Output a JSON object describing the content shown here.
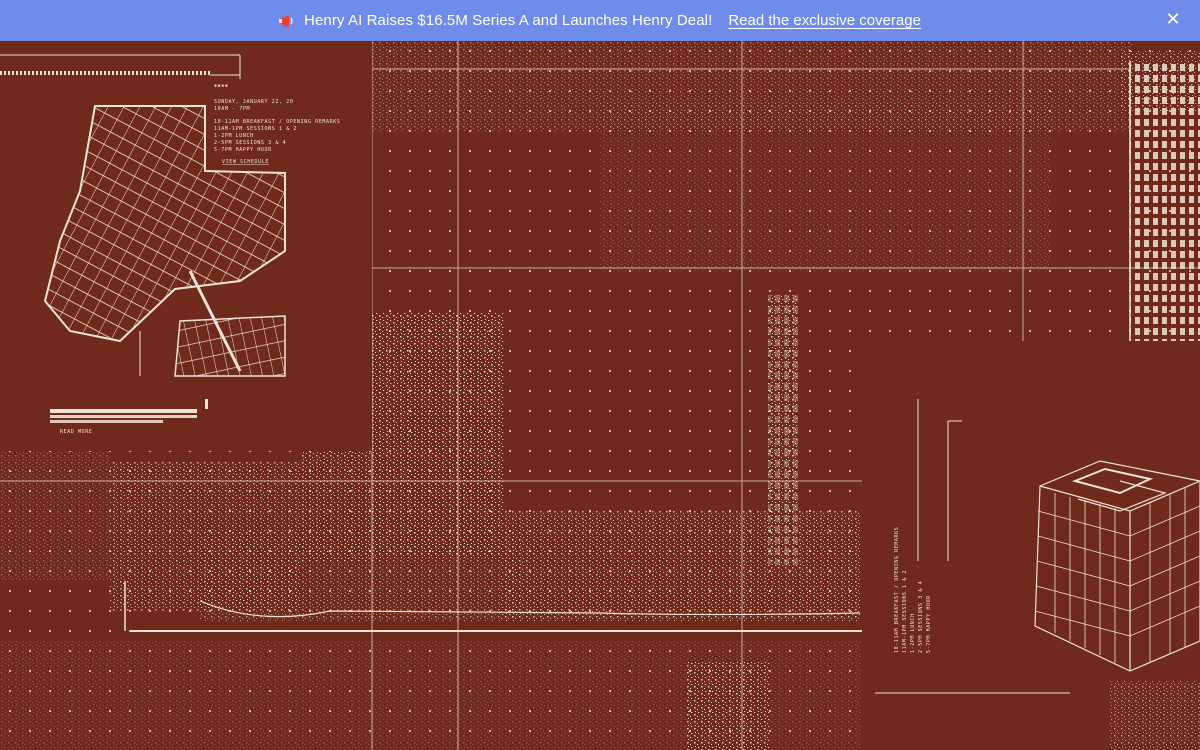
{
  "banner": {
    "icon": "megaphone-icon",
    "message": "Henry AI Raises $16.5M Series A and Launches Henry Deal!",
    "link_text": "Read the exclusive coverage",
    "close_icon": "close-icon",
    "background": "#6f8cea"
  },
  "hero": {
    "background": "#702a1c",
    "ink": "#efe3d6",
    "schedule_date": "SUNDAY, JANUARY 22, 20",
    "schedule_time": "10AM - 7PM",
    "schedule_rows": [
      "10-11AM   BREAKFAST / OPENING REMARKS",
      "11AM-1PM  SESSIONS 1 & 2",
      "1-2PM     LUNCH",
      "2-5PM     SESSIONS 3 & 4",
      "5-7PM     HAPPY HOUR"
    ],
    "view_schedule": "VIEW SCHEDULE",
    "read_more": "READ MORE",
    "vertical_rows": [
      "10-11AM   BREAKFAST / OPENING REMARKS",
      "11AM-1PM  SESSIONS 1 & 2",
      "1-2PM     LUNCH",
      "2-5PM     SESSIONS 3 & 4",
      "5-7PM     HAPPY HOUR"
    ]
  }
}
